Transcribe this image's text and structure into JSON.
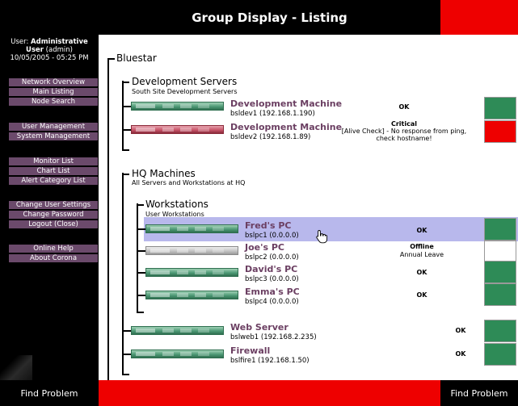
{
  "header": {
    "title": "Group Display - Listing"
  },
  "user": {
    "label": "User:",
    "name": "Administrative User",
    "login": "(admin)",
    "datetime": "10/05/2005 - 05:25 PM"
  },
  "nav": {
    "network_overview": "Network Overview",
    "main_listing": "Main Listing",
    "node_search": "Node Search",
    "user_management": "User Management",
    "system_management": "System Management",
    "monitor_list": "Monitor List",
    "chart_list": "Chart List",
    "alert_category_list": "Alert Category List",
    "change_user_settings": "Change User Settings",
    "change_password": "Change Password",
    "logout": "Logout (Close)",
    "online_help": "Online Help",
    "about_corona": "About Corona"
  },
  "footer": {
    "left": "Find Problem",
    "right": "Find Problem"
  },
  "tree": {
    "root": "Bluestar",
    "groups": {
      "dev": {
        "title": "Development Servers",
        "subtitle": "South Site Development Servers"
      },
      "hq": {
        "title": "HQ Machines",
        "subtitle": "All Servers and Workstations at HQ"
      },
      "ws": {
        "title": "Workstations",
        "subtitle": "User Workstations"
      }
    },
    "hosts": {
      "bsldev1": {
        "name": "Development Machine",
        "address": "bsldev1 (192.168.1.190)",
        "status": "OK",
        "note": "",
        "color": "#2e8b57"
      },
      "bsldev2": {
        "name": "Development Machine",
        "address": "bsldev2 (192.168.1.89)",
        "status": "Critical",
        "note": "[Alive Check] - No response from ping, check hostname!",
        "color": "#ee0000"
      },
      "bslpc1": {
        "name": "Fred's PC",
        "address": "bslpc1 (0.0.0.0)",
        "status": "OK",
        "note": "",
        "color": "#2e8b57"
      },
      "bslpc2": {
        "name": "Joe's PC",
        "address": "bslpc2 (0.0.0.0)",
        "status": "Offline",
        "note": "Annual Leave",
        "color": "#ffffff"
      },
      "bslpc3": {
        "name": "David's PC",
        "address": "bslpc3 (0.0.0.0)",
        "status": "OK",
        "note": "",
        "color": "#2e8b57"
      },
      "bslpc4": {
        "name": "Emma's PC",
        "address": "bslpc4 (0.0.0.0)",
        "status": "OK",
        "note": "",
        "color": "#2e8b57"
      },
      "bslweb1": {
        "name": "Web Server",
        "address": "bslweb1 (192.168.2.235)",
        "status": "OK",
        "note": "",
        "color": "#2e8b57"
      },
      "bslfire1": {
        "name": "Firewall",
        "address": "bslfire1 (192.168.1.50)",
        "status": "OK",
        "note": "",
        "color": "#2e8b57"
      }
    }
  },
  "colors": {
    "header_accent": "#ee0000",
    "nav_button": "#6b4a6b",
    "host_link": "#6b3f62",
    "selected_row": "#b8b8ec",
    "status_ok": "#2e8b57",
    "status_critical": "#ee0000",
    "status_offline": "#ffffff"
  },
  "icons": {
    "cursor": "hand-pointer-icon",
    "server": "server-rack-icon"
  }
}
